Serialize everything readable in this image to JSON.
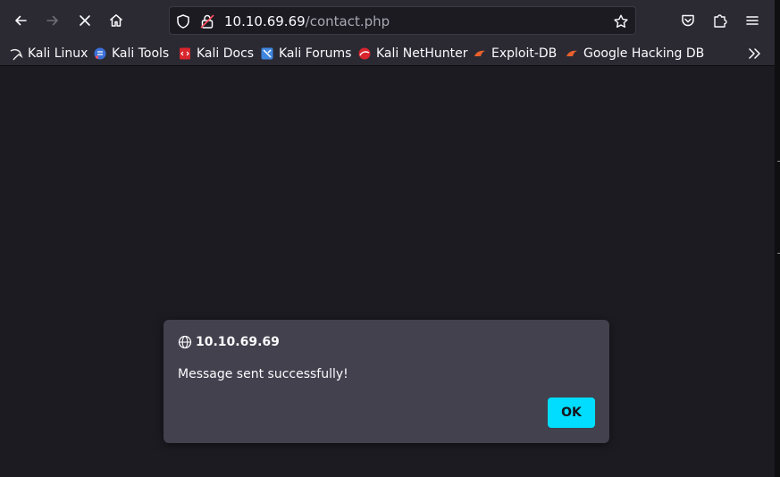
{
  "toolbar": {
    "back_icon": "arrow-left-icon",
    "forward_icon": "arrow-right-icon",
    "stop_icon": "close-icon",
    "home_icon": "home-icon",
    "pocket_icon": "pocket-icon",
    "extensions_icon": "puzzle-icon",
    "menu_icon": "hamburger-menu-icon"
  },
  "urlbar": {
    "host": "10.10.69.69",
    "path": "/contact.php",
    "shield_icon": "shield-icon",
    "insecure_lock_icon": "insecure-lock-icon",
    "bookmark_star_icon": "star-icon"
  },
  "bookmarks": [
    {
      "label": "Kali Linux",
      "icon": "kali-dragon-icon"
    },
    {
      "label": "Kali Tools",
      "icon": "kali-tools-icon"
    },
    {
      "label": "Kali Docs",
      "icon": "kali-docs-icon"
    },
    {
      "label": "Kali Forums",
      "icon": "kali-forums-icon"
    },
    {
      "label": "Kali NetHunter",
      "icon": "kali-nethunter-icon"
    },
    {
      "label": "Exploit-DB",
      "icon": "exploit-db-icon"
    },
    {
      "label": "Google Hacking DB",
      "icon": "ghdb-icon"
    }
  ],
  "dialog": {
    "origin": "10.10.69.69",
    "message": "Message sent successfully!",
    "ok_label": "OK"
  },
  "colors": {
    "toolbar_bg": "#2b2a33",
    "content_bg": "#1c1b22",
    "dialog_bg": "#42414d",
    "accent": "#00ddff"
  }
}
